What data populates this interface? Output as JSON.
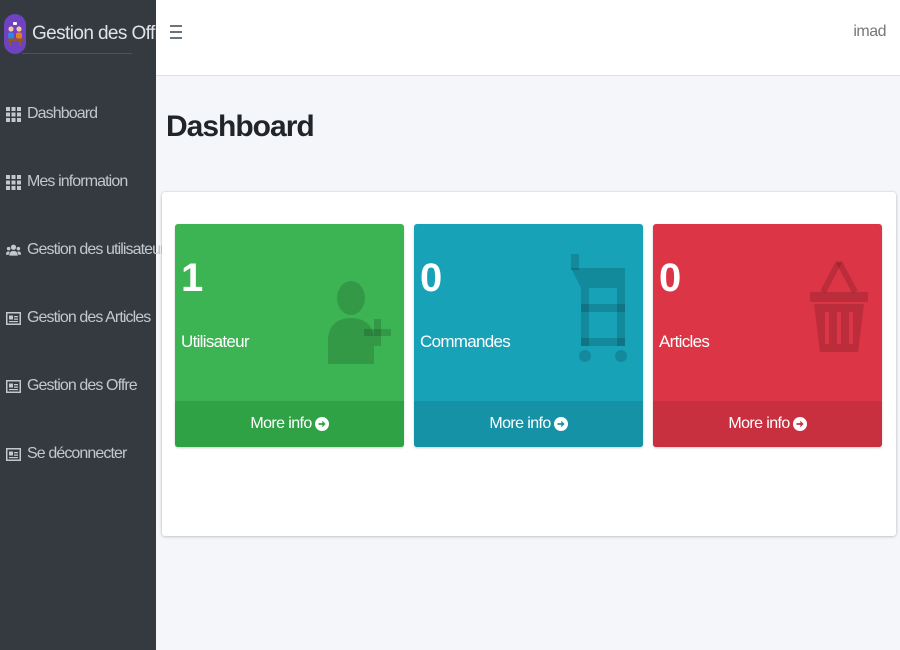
{
  "brand": {
    "title": "Gestion des Offre",
    "logo_icon": "meeting-logo-icon",
    "logo_color": "#6f42c1"
  },
  "sidebar": {
    "background": "#343a40",
    "items": [
      {
        "label": "Dashboard",
        "icon": "grid-icon"
      },
      {
        "label": "Mes information",
        "icon": "grid-icon"
      },
      {
        "label": "Gestion des utilisateurs",
        "icon": "users-icon"
      },
      {
        "label": "Gestion des Articles",
        "icon": "id-card-icon"
      },
      {
        "label": "Gestion des Offre",
        "icon": "id-card-icon"
      },
      {
        "label": "Se déconnecter",
        "icon": "id-card-icon"
      }
    ]
  },
  "topbar": {
    "menu_icon": "hamburger-icon",
    "user_name": "imad"
  },
  "main": {
    "page_title": "Dashboard",
    "boxes": [
      {
        "number": "1",
        "label": "Utilisateur",
        "footer": "More info",
        "color": "#3cb454",
        "icon": "user-plus-icon"
      },
      {
        "number": "0",
        "label": "Commandes",
        "footer": "More info",
        "color": "#17a2b8",
        "icon": "shopping-cart-icon"
      },
      {
        "number": "0",
        "label": "Articles",
        "footer": "More info",
        "color": "#dc3545",
        "icon": "shopping-basket-icon"
      }
    ]
  }
}
